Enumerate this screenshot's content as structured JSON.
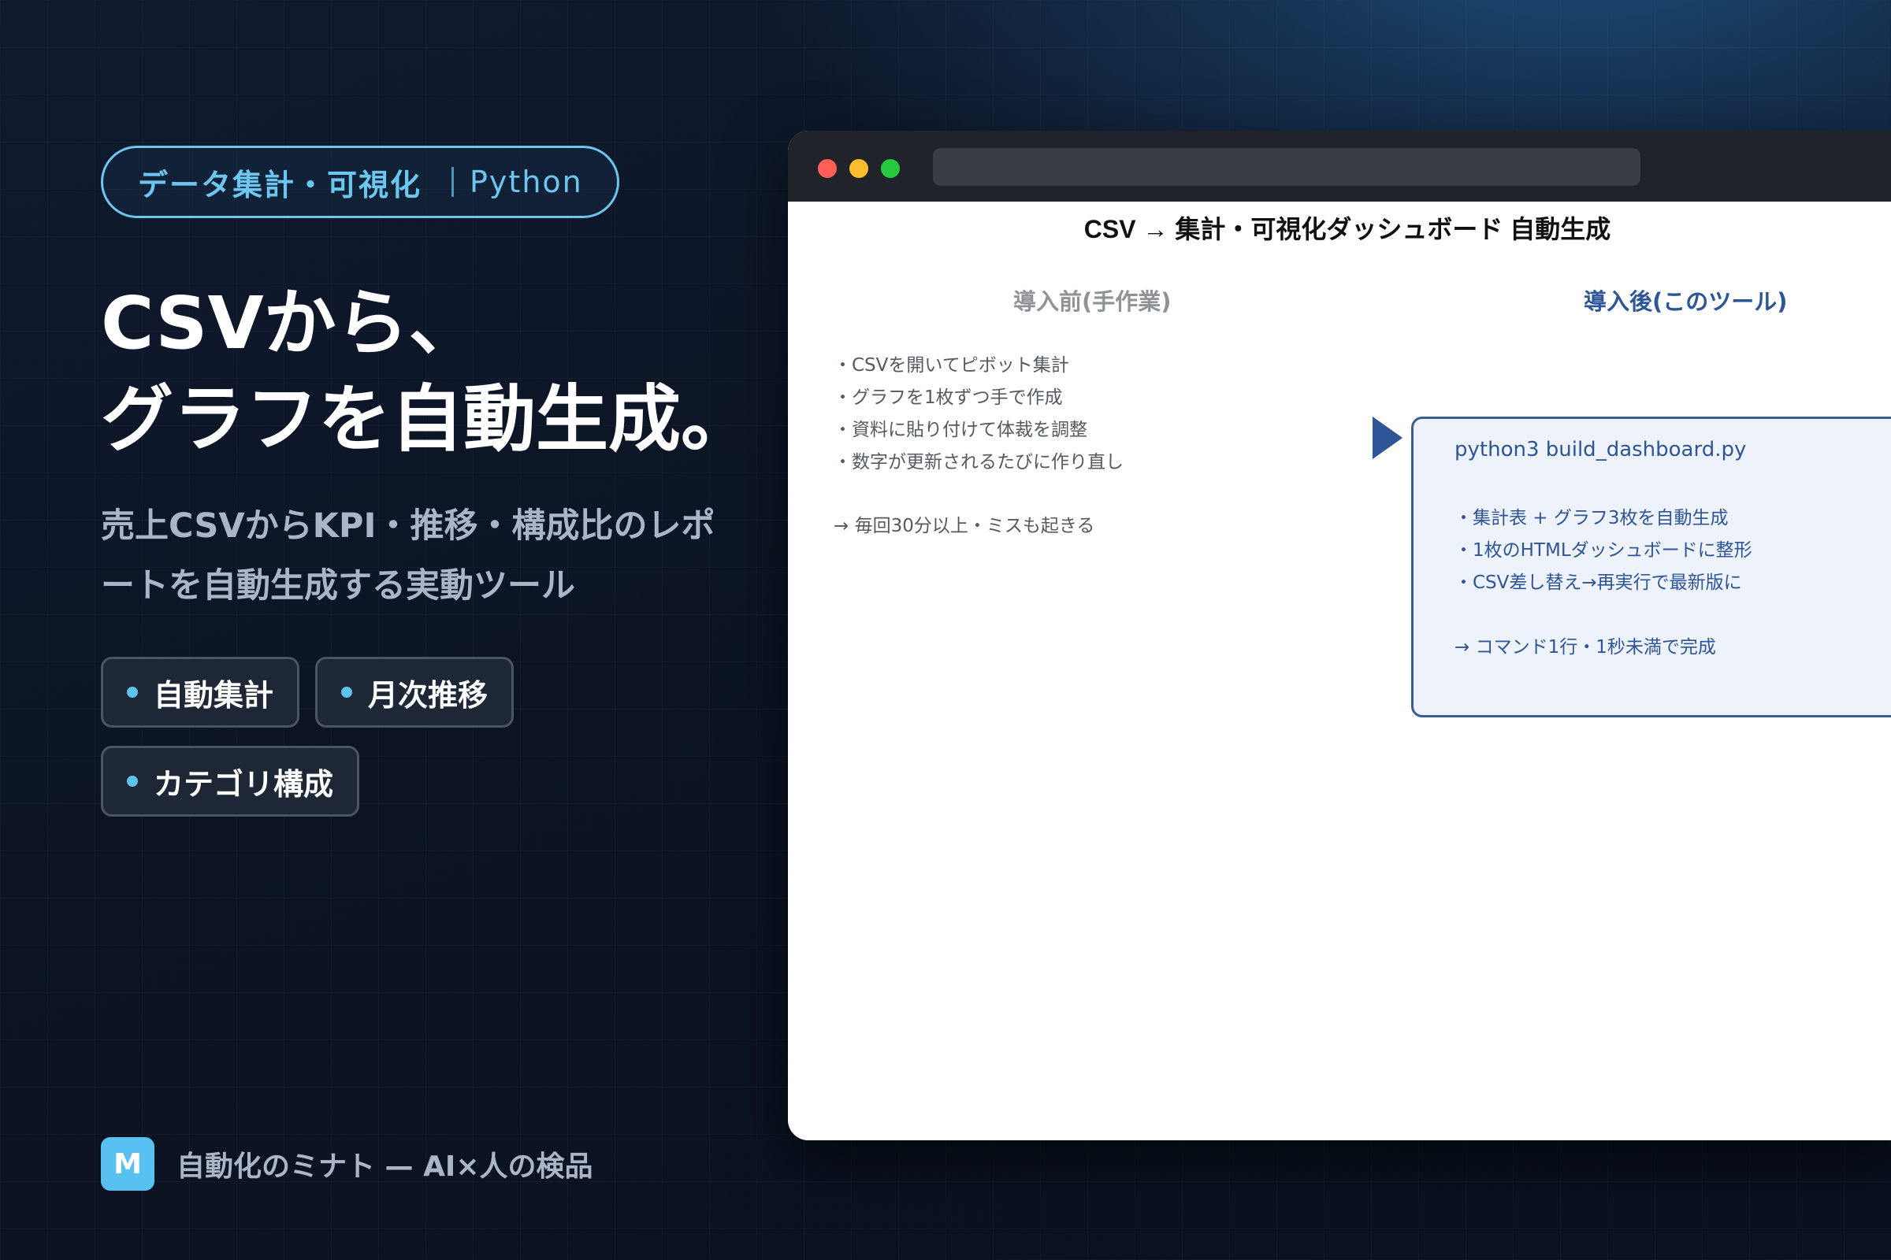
{
  "hero": {
    "tag_main": "データ集計・可視化",
    "tag_sub": "Python",
    "headline_line1": "CSVから、",
    "headline_line2": "グラフを自動生成。",
    "description": "売上CSVからKPI・推移・構成比のレポートを自動生成する実動ツール",
    "chips": [
      "自動集計",
      "月次推移",
      "カテゴリ構成"
    ]
  },
  "brand": {
    "logo_letter": "M",
    "text": "自動化のミナト — AI×人の検品"
  },
  "window": {
    "title": "CSV → 集計・可視化ダッシュボード 自動生成",
    "before": {
      "heading": "導入前(手作業)",
      "items": [
        "・CSVを開いてピボット集計",
        "・グラフを1枚ずつ手で作成",
        "・資料に貼り付けて体裁を調整",
        "・数字が更新されるたびに作り直し"
      ],
      "note": "→ 毎回30分以上・ミスも起きる"
    },
    "after": {
      "heading": "導入後(このツール)",
      "command": "python3 build_dashboard.py",
      "items": [
        "・集計表 + グラフ3枚を自動生成",
        "・1枚のHTMLダッシュボードに整形",
        "・CSV差し替え→再実行で最新版に"
      ],
      "note": "→ コマンド1行・1秒未満で完成"
    }
  },
  "colors": {
    "accent": "#6cc6f0",
    "after_blue": "#2e5597",
    "background": "#0f1a2e"
  }
}
